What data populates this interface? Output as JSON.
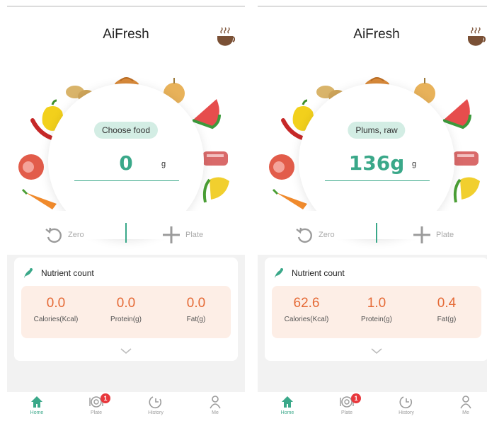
{
  "app": {
    "title": "AiFresh"
  },
  "screens": [
    {
      "food_chip": "Choose food",
      "weight": "0",
      "unit": "g",
      "zero_label": "Zero",
      "plate_label": "Plate",
      "nutrient": {
        "title": "Nutrient count",
        "items": [
          {
            "value": "0.0",
            "label": "Calories(Kcal)"
          },
          {
            "value": "0.0",
            "label": "Protein(g)"
          },
          {
            "value": "0.0",
            "label": "Fat(g)"
          }
        ]
      }
    },
    {
      "food_chip": "Plums, raw",
      "weight": "136g",
      "unit": "g",
      "zero_label": "Zero",
      "plate_label": "Plate",
      "nutrient": {
        "title": "Nutrient count",
        "items": [
          {
            "value": "62.6",
            "label": "Calories(Kcal)"
          },
          {
            "value": "1.0",
            "label": "Protein(g)"
          },
          {
            "value": "0.4",
            "label": "Fat(g)"
          }
        ]
      }
    }
  ],
  "tabs": [
    {
      "label": "Home",
      "icon": "home-icon",
      "active": true
    },
    {
      "label": "Plate",
      "icon": "plate-icon",
      "badge": "1"
    },
    {
      "label": "History",
      "icon": "history-icon"
    },
    {
      "label": "Me",
      "icon": "user-icon"
    }
  ],
  "colors": {
    "accent": "#3aa889",
    "nutrient_value": "#e56a36",
    "nutrient_bg": "#fdeee6",
    "chip_bg": "#d3ede4",
    "badge": "#e8383d"
  }
}
